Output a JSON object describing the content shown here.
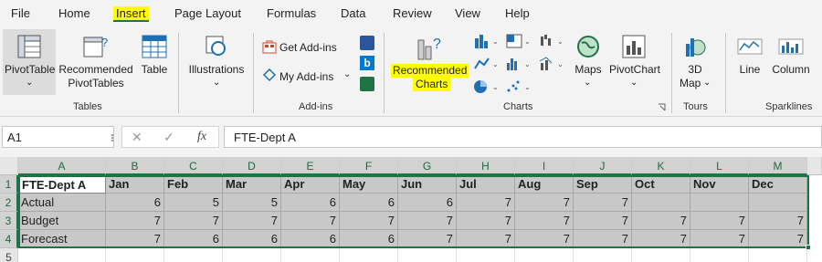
{
  "menu": {
    "file": "File",
    "home": "Home",
    "insert": "Insert",
    "page_layout": "Page Layout",
    "formulas": "Formulas",
    "data": "Data",
    "review": "Review",
    "view": "View",
    "help": "Help"
  },
  "ribbon": {
    "tables": {
      "pivottable": "PivotTable",
      "pivottable_arrow": "⌄",
      "recommended_line1": "Recommended",
      "recommended_line2": "PivotTables",
      "table": "Table",
      "group": "Tables"
    },
    "illustrations": {
      "label": "Illustrations",
      "arrow": "⌄"
    },
    "addins": {
      "get": "Get Add-ins",
      "my": "My Add-ins",
      "group": "Add-ins"
    },
    "charts": {
      "rec_line1": "Recommended",
      "rec_line2": "Charts",
      "maps": "Maps",
      "maps_arrow": "⌄",
      "pivotchart": "PivotChart",
      "pivotchart_arrow": "⌄",
      "group": "Charts"
    },
    "tours": {
      "line1": "3D",
      "line2": "Map",
      "arrow": "⌄",
      "group": "Tours"
    },
    "sparklines": {
      "line": "Line",
      "column": "Column",
      "group": "Sparklines"
    }
  },
  "formula_bar": {
    "name_box": "A1",
    "cancel": "✕",
    "enter": "✓",
    "fx": "fx",
    "content": "FTE-Dept A"
  },
  "columns": [
    "A",
    "B",
    "C",
    "D",
    "E",
    "F",
    "G",
    "H",
    "I",
    "J",
    "K",
    "L",
    "M"
  ],
  "rows": [
    "1",
    "2",
    "3",
    "4",
    "5"
  ],
  "sheet": {
    "header": [
      "FTE-Dept A",
      "Jan",
      "Feb",
      "Mar",
      "Apr",
      "May",
      "Jun",
      "Jul",
      "Aug",
      "Sep",
      "Oct",
      "Nov",
      "Dec"
    ],
    "data": [
      [
        "Actual",
        "6",
        "5",
        "5",
        "6",
        "6",
        "6",
        "7",
        "7",
        "7",
        "",
        "",
        ""
      ],
      [
        "Budget",
        "7",
        "7",
        "7",
        "7",
        "7",
        "7",
        "7",
        "7",
        "7",
        "7",
        "7",
        "7"
      ],
      [
        "Forecast",
        "7",
        "6",
        "6",
        "6",
        "6",
        "7",
        "7",
        "7",
        "7",
        "7",
        "7",
        "7"
      ]
    ]
  },
  "colors": {
    "accent": "#217346",
    "highlight": "#ffff00"
  }
}
